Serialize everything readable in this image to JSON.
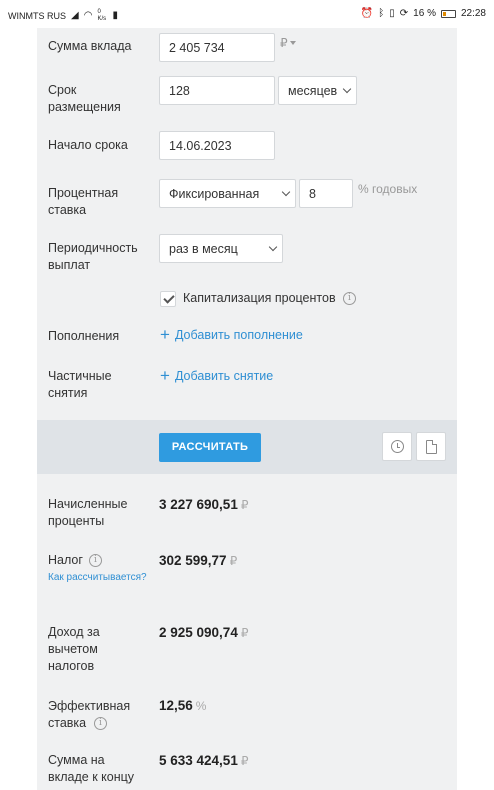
{
  "status_bar": {
    "carrier": "WINMTS RUS",
    "net_speed": "0 K/s",
    "battery_pct": "16 %",
    "time": "22:28"
  },
  "form": {
    "deposit_amount": {
      "label": "Сумма вклада",
      "value": "2 405 734",
      "currency": "₽"
    },
    "term": {
      "label": "Срок размещения",
      "value": "128",
      "unit": "месяцев"
    },
    "start_date": {
      "label": "Начало срока",
      "value": "14.06.2023"
    },
    "interest_rate": {
      "label": "Процентная ставка",
      "type": "Фиксированная",
      "value": "8",
      "unit": "% годовых"
    },
    "payout_frequency": {
      "label": "Периодичность выплат",
      "value": "раз в месяц"
    },
    "capitalization": {
      "label": "Капитализация процентов",
      "checked": true
    },
    "replenishments": {
      "label": "Пополнения",
      "link": "Добавить пополнение"
    },
    "partial_withdrawals": {
      "label": "Частичные снятия",
      "link": "Добавить снятие"
    }
  },
  "actions": {
    "calculate_label": "РАССЧИТАТЬ"
  },
  "results": {
    "accrued_interest": {
      "label": "Начисленные проценты",
      "value": "3 227 690,51",
      "currency": "₽"
    },
    "tax": {
      "label": "Налог",
      "value": "302 599,77",
      "currency": "₽",
      "link": "Как рассчитывается?"
    },
    "income_after_tax": {
      "label": "Доход за вычетом налогов",
      "value": "2 925 090,74",
      "currency": "₽"
    },
    "effective_rate": {
      "label": "Эффективная ставка",
      "value": "12,56",
      "unit": "%"
    },
    "end_balance": {
      "label": "Сумма на вкладе к концу",
      "value": "5 633 424,51",
      "currency": "₽"
    }
  },
  "icons": [
    "signal-icon",
    "wifi-icon",
    "alarm-icon",
    "bluetooth-icon",
    "vibrate-icon",
    "battery-icon",
    "info-icon",
    "history-icon",
    "document-icon",
    "plus-icon",
    "checkmark-icon",
    "chevron-down-icon"
  ],
  "colors": {
    "accent": "#2f9be0",
    "link": "#2f8fd3",
    "panel_bg": "#f0f1f2",
    "bar_bg": "#dfe3e7"
  }
}
